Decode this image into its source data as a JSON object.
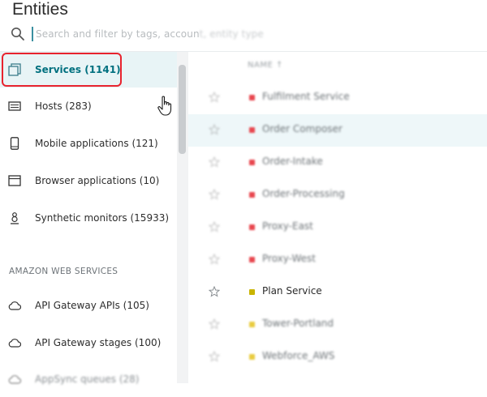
{
  "header": {
    "title": "Entities",
    "search": {
      "placeholder_visible": "Search and filter by tags, accoun",
      "placeholder_faded": "t, entity type"
    }
  },
  "sidebar": {
    "items": [
      {
        "label": "Services (1141)",
        "icon": "services-icon",
        "active": true
      },
      {
        "label": "Hosts (283)",
        "icon": "hosts-icon",
        "active": false
      },
      {
        "label": "Mobile applications (121)",
        "icon": "mobile-icon",
        "active": false
      },
      {
        "label": "Browser applications (10)",
        "icon": "browser-icon",
        "active": false
      },
      {
        "label": "Synthetic monitors (15933)",
        "icon": "synthetic-icon",
        "active": false
      }
    ],
    "section_aws": {
      "heading": "AMAZON WEB SERVICES",
      "items": [
        {
          "label": "API Gateway APIs (105)",
          "icon": "cloud-icon"
        },
        {
          "label": "API Gateway stages (100)",
          "icon": "cloud-icon"
        },
        {
          "label": "AppSync queues (28)",
          "icon": "cloud-icon"
        }
      ]
    }
  },
  "table": {
    "name_header": "NAME ↑",
    "rows": [
      {
        "name": "Fulfilment Service",
        "status_color": "#e8474f",
        "blurred": true
      },
      {
        "name": "Order Composer",
        "status_color": "#e8474f",
        "blurred": true
      },
      {
        "name": "Order-Intake",
        "status_color": "#e8474f",
        "blurred": true
      },
      {
        "name": "Order-Processing",
        "status_color": "#e8474f",
        "blurred": true
      },
      {
        "name": "Proxy-East",
        "status_color": "#e8474f",
        "blurred": true
      },
      {
        "name": "Proxy-West",
        "status_color": "#e8474f",
        "blurred": true
      },
      {
        "name": "Plan Service",
        "status_color": "#c9b400",
        "blurred": false
      },
      {
        "name": "Tower-Portland",
        "status_color": "#e9cc40",
        "blurred": true
      },
      {
        "name": "Webforce_AWS",
        "status_color": "#e9cc40",
        "blurred": true
      }
    ]
  },
  "colors": {
    "accent": "#00707f",
    "highlight": "#e8232e",
    "active_bg": "#e8f4f6"
  }
}
